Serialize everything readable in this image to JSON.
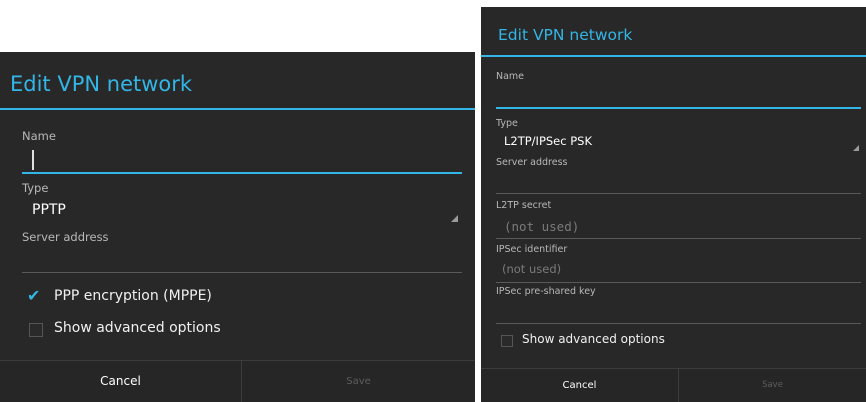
{
  "left_dialog": {
    "title": "Edit VPN network",
    "name_label": "Name",
    "type_label": "Type",
    "type_value": "PPTP",
    "server_label": "Server address",
    "ppp_label": "PPP encryption (MPPE)",
    "ppp_checked": true,
    "advanced_label": "Show advanced options",
    "advanced_checked": false,
    "cancel_label": "Cancel",
    "save_label": "Save"
  },
  "right_dialog": {
    "title": "Edit VPN network",
    "name_label": "Name",
    "type_label": "Type",
    "type_value": "L2TP/IPSec PSK",
    "server_label": "Server address",
    "l2tp_label": "L2TP secret",
    "l2tp_value": "(not used)",
    "ipsec_id_label": "IPSec identifier",
    "ipsec_id_value": "(not used)",
    "psk_label": "IPSec pre-shared key",
    "advanced_label": "Show advanced options",
    "advanced_checked": false,
    "cancel_label": "Cancel",
    "save_label": "Save"
  },
  "colors": {
    "accent": "#33b5e5",
    "dialog_bg": "#282828",
    "disabled_text": "#5d5d5d"
  }
}
